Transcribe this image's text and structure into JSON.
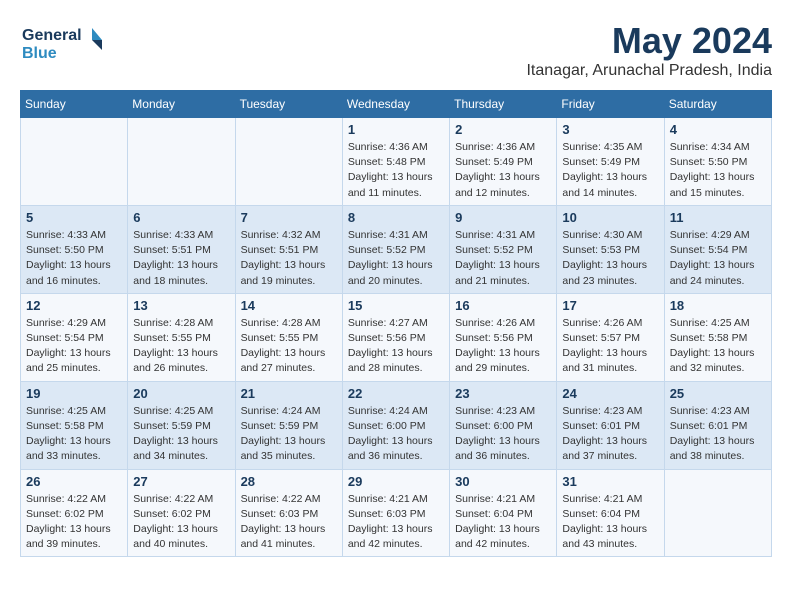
{
  "logo": {
    "line1": "General",
    "line2": "Blue"
  },
  "title": "May 2024",
  "location": "Itanagar, Arunachal Pradesh, India",
  "days_of_week": [
    "Sunday",
    "Monday",
    "Tuesday",
    "Wednesday",
    "Thursday",
    "Friday",
    "Saturday"
  ],
  "weeks": [
    [
      {
        "day": "",
        "info": ""
      },
      {
        "day": "",
        "info": ""
      },
      {
        "day": "",
        "info": ""
      },
      {
        "day": "1",
        "info": "Sunrise: 4:36 AM\nSunset: 5:48 PM\nDaylight: 13 hours\nand 11 minutes."
      },
      {
        "day": "2",
        "info": "Sunrise: 4:36 AM\nSunset: 5:49 PM\nDaylight: 13 hours\nand 12 minutes."
      },
      {
        "day": "3",
        "info": "Sunrise: 4:35 AM\nSunset: 5:49 PM\nDaylight: 13 hours\nand 14 minutes."
      },
      {
        "day": "4",
        "info": "Sunrise: 4:34 AM\nSunset: 5:50 PM\nDaylight: 13 hours\nand 15 minutes."
      }
    ],
    [
      {
        "day": "5",
        "info": "Sunrise: 4:33 AM\nSunset: 5:50 PM\nDaylight: 13 hours\nand 16 minutes."
      },
      {
        "day": "6",
        "info": "Sunrise: 4:33 AM\nSunset: 5:51 PM\nDaylight: 13 hours\nand 18 minutes."
      },
      {
        "day": "7",
        "info": "Sunrise: 4:32 AM\nSunset: 5:51 PM\nDaylight: 13 hours\nand 19 minutes."
      },
      {
        "day": "8",
        "info": "Sunrise: 4:31 AM\nSunset: 5:52 PM\nDaylight: 13 hours\nand 20 minutes."
      },
      {
        "day": "9",
        "info": "Sunrise: 4:31 AM\nSunset: 5:52 PM\nDaylight: 13 hours\nand 21 minutes."
      },
      {
        "day": "10",
        "info": "Sunrise: 4:30 AM\nSunset: 5:53 PM\nDaylight: 13 hours\nand 23 minutes."
      },
      {
        "day": "11",
        "info": "Sunrise: 4:29 AM\nSunset: 5:54 PM\nDaylight: 13 hours\nand 24 minutes."
      }
    ],
    [
      {
        "day": "12",
        "info": "Sunrise: 4:29 AM\nSunset: 5:54 PM\nDaylight: 13 hours\nand 25 minutes."
      },
      {
        "day": "13",
        "info": "Sunrise: 4:28 AM\nSunset: 5:55 PM\nDaylight: 13 hours\nand 26 minutes."
      },
      {
        "day": "14",
        "info": "Sunrise: 4:28 AM\nSunset: 5:55 PM\nDaylight: 13 hours\nand 27 minutes."
      },
      {
        "day": "15",
        "info": "Sunrise: 4:27 AM\nSunset: 5:56 PM\nDaylight: 13 hours\nand 28 minutes."
      },
      {
        "day": "16",
        "info": "Sunrise: 4:26 AM\nSunset: 5:56 PM\nDaylight: 13 hours\nand 29 minutes."
      },
      {
        "day": "17",
        "info": "Sunrise: 4:26 AM\nSunset: 5:57 PM\nDaylight: 13 hours\nand 31 minutes."
      },
      {
        "day": "18",
        "info": "Sunrise: 4:25 AM\nSunset: 5:58 PM\nDaylight: 13 hours\nand 32 minutes."
      }
    ],
    [
      {
        "day": "19",
        "info": "Sunrise: 4:25 AM\nSunset: 5:58 PM\nDaylight: 13 hours\nand 33 minutes."
      },
      {
        "day": "20",
        "info": "Sunrise: 4:25 AM\nSunset: 5:59 PM\nDaylight: 13 hours\nand 34 minutes."
      },
      {
        "day": "21",
        "info": "Sunrise: 4:24 AM\nSunset: 5:59 PM\nDaylight: 13 hours\nand 35 minutes."
      },
      {
        "day": "22",
        "info": "Sunrise: 4:24 AM\nSunset: 6:00 PM\nDaylight: 13 hours\nand 36 minutes."
      },
      {
        "day": "23",
        "info": "Sunrise: 4:23 AM\nSunset: 6:00 PM\nDaylight: 13 hours\nand 36 minutes."
      },
      {
        "day": "24",
        "info": "Sunrise: 4:23 AM\nSunset: 6:01 PM\nDaylight: 13 hours\nand 37 minutes."
      },
      {
        "day": "25",
        "info": "Sunrise: 4:23 AM\nSunset: 6:01 PM\nDaylight: 13 hours\nand 38 minutes."
      }
    ],
    [
      {
        "day": "26",
        "info": "Sunrise: 4:22 AM\nSunset: 6:02 PM\nDaylight: 13 hours\nand 39 minutes."
      },
      {
        "day": "27",
        "info": "Sunrise: 4:22 AM\nSunset: 6:02 PM\nDaylight: 13 hours\nand 40 minutes."
      },
      {
        "day": "28",
        "info": "Sunrise: 4:22 AM\nSunset: 6:03 PM\nDaylight: 13 hours\nand 41 minutes."
      },
      {
        "day": "29",
        "info": "Sunrise: 4:21 AM\nSunset: 6:03 PM\nDaylight: 13 hours\nand 42 minutes."
      },
      {
        "day": "30",
        "info": "Sunrise: 4:21 AM\nSunset: 6:04 PM\nDaylight: 13 hours\nand 42 minutes."
      },
      {
        "day": "31",
        "info": "Sunrise: 4:21 AM\nSunset: 6:04 PM\nDaylight: 13 hours\nand 43 minutes."
      },
      {
        "day": "",
        "info": ""
      }
    ]
  ]
}
